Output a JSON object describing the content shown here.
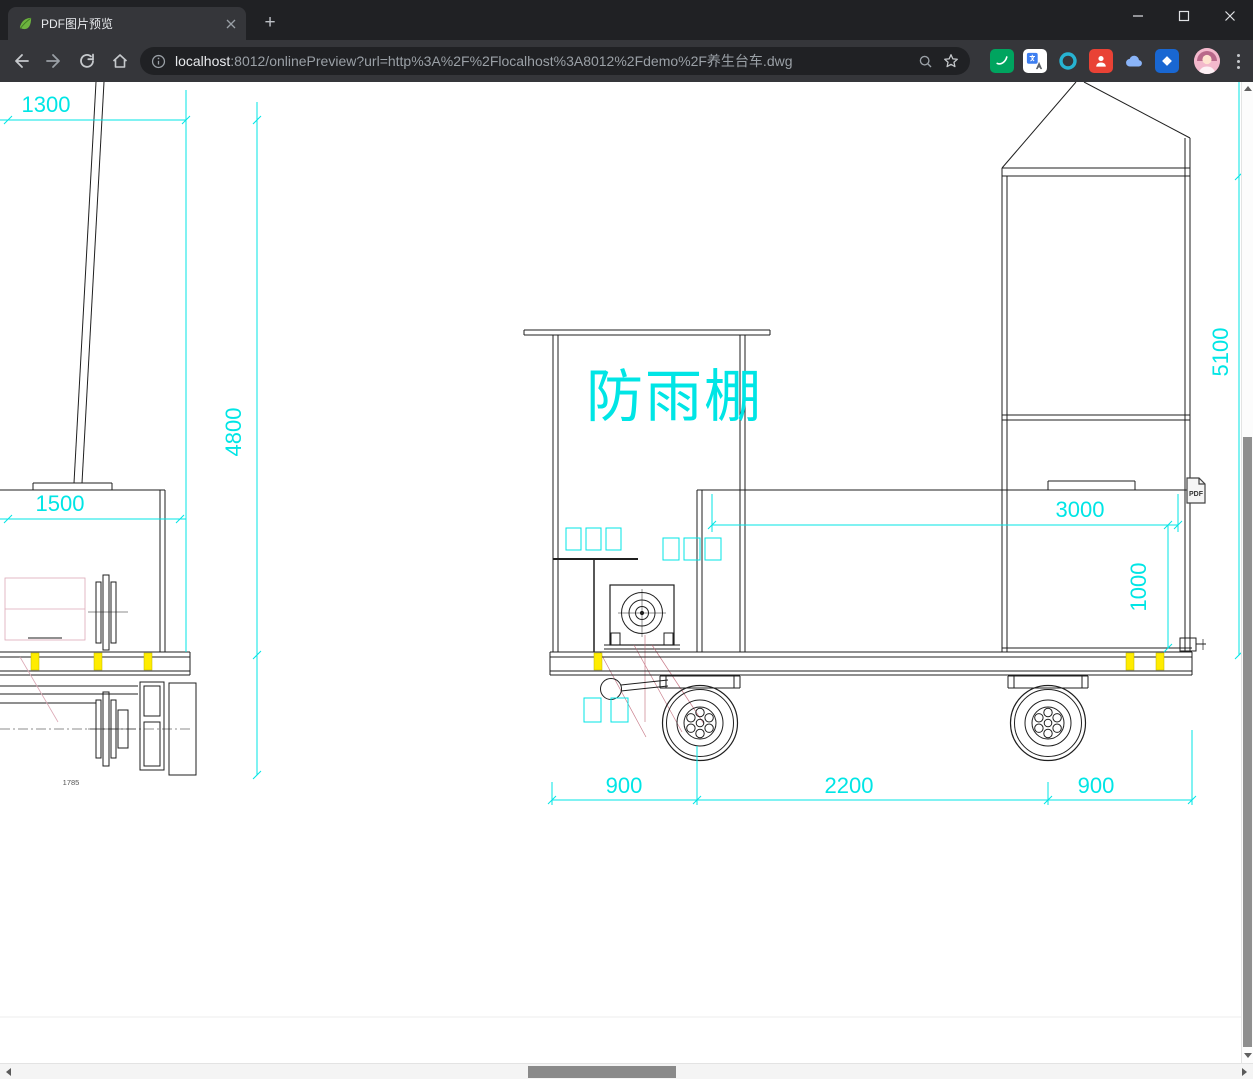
{
  "browser": {
    "tab_title": "PDF图片预览",
    "new_tab_glyph": "+",
    "url": {
      "host": "localhost",
      "rest": ":8012/onlinePreview?url=http%3A%2F%2Flocalhost%3A8012%2Fdemo%2F养生台车.dwg"
    }
  },
  "content": {
    "pdf_badge": "PDF",
    "shelter_label": "防雨棚",
    "dims": {
      "top_width": "1300",
      "left_height": "4800",
      "hopper_width": "1500",
      "right_height": "5100",
      "deck_length": "3000",
      "deck_height": "1000",
      "axle_left": "900",
      "axle_mid": "2200",
      "axle_right": "900",
      "note_small": "1785"
    },
    "colors": {
      "dimension": "#00e5e5",
      "highlight": "#ffec00",
      "construction": "#c06878"
    }
  }
}
